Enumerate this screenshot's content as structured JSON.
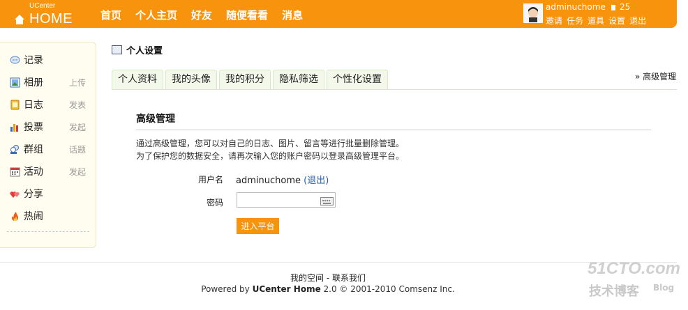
{
  "header": {
    "logo_small": "UCenter",
    "logo_big": "HOME",
    "nav": [
      "首页",
      "个人主页",
      "好友",
      "随便看看",
      "消息"
    ],
    "username": "adminuchome",
    "credit": "25",
    "user_links": [
      "邀请",
      "任务",
      "道具",
      "设置",
      "退出"
    ]
  },
  "sidebar": {
    "items": [
      {
        "label": "记录",
        "action": "",
        "icon": "speech-bubble-icon"
      },
      {
        "label": "相册",
        "action": "上传",
        "icon": "picture-icon"
      },
      {
        "label": "日志",
        "action": "发表",
        "icon": "notebook-icon"
      },
      {
        "label": "投票",
        "action": "发起",
        "icon": "bar-chart-icon"
      },
      {
        "label": "群组",
        "action": "话题",
        "icon": "group-icon"
      },
      {
        "label": "活动",
        "action": "发起",
        "icon": "calendar-icon"
      },
      {
        "label": "分享",
        "action": "",
        "icon": "hearts-icon"
      },
      {
        "label": "热闹",
        "action": "",
        "icon": "fire-icon"
      }
    ]
  },
  "main": {
    "page_title": "个人设置",
    "tabs": [
      "个人资料",
      "我的头像",
      "我的积分",
      "隐私筛选",
      "个性化设置"
    ],
    "top_right_link": "» 高级管理",
    "section_title": "高级管理",
    "desc_line1": "通过高级管理，您可以对自己的日志、图片、留言等进行批量删除管理。",
    "desc_line2": "为了保护您的数据安全，请再次输入您的账户密码以登录高级管理平台。",
    "username_label": "用户名",
    "username_value": "adminuchome",
    "logout_link": "(退出)",
    "password_label": "密码",
    "password_value": "",
    "submit_label": "进入平台"
  },
  "footer": {
    "links": "我的空间 - 联系我们",
    "powered_prefix": "Powered by ",
    "powered_product": "UCenter Home",
    "powered_suffix": " 2.0 © 2001-2010 Comsenz Inc."
  },
  "watermark": {
    "site": "51CTO.com",
    "cn": "技术博客",
    "blog": "Blog"
  },
  "colors": {
    "brand": "#f8930e",
    "tab_bg": "#f3f8ea",
    "sidebar_bg": "#fffdf0"
  }
}
